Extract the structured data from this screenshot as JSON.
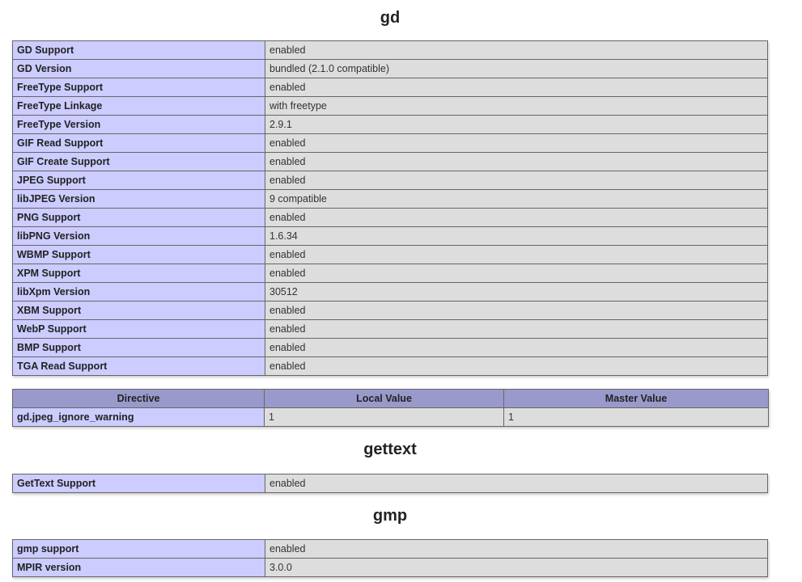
{
  "sections": {
    "gd": {
      "title": "gd",
      "rows": [
        {
          "label": "GD Support",
          "value": "enabled"
        },
        {
          "label": "GD Version",
          "value": "bundled (2.1.0 compatible)"
        },
        {
          "label": "FreeType Support",
          "value": "enabled"
        },
        {
          "label": "FreeType Linkage",
          "value": "with freetype"
        },
        {
          "label": "FreeType Version",
          "value": "2.9.1"
        },
        {
          "label": "GIF Read Support",
          "value": "enabled"
        },
        {
          "label": "GIF Create Support",
          "value": "enabled"
        },
        {
          "label": "JPEG Support",
          "value": "enabled"
        },
        {
          "label": "libJPEG Version",
          "value": "9 compatible"
        },
        {
          "label": "PNG Support",
          "value": "enabled"
        },
        {
          "label": "libPNG Version",
          "value": "1.6.34"
        },
        {
          "label": "WBMP Support",
          "value": "enabled"
        },
        {
          "label": "XPM Support",
          "value": "enabled"
        },
        {
          "label": "libXpm Version",
          "value": "30512"
        },
        {
          "label": "XBM Support",
          "value": "enabled"
        },
        {
          "label": "WebP Support",
          "value": "enabled"
        },
        {
          "label": "BMP Support",
          "value": "enabled"
        },
        {
          "label": "TGA Read Support",
          "value": "enabled"
        }
      ],
      "directives": {
        "headers": [
          "Directive",
          "Local Value",
          "Master Value"
        ],
        "rows": [
          {
            "directive": "gd.jpeg_ignore_warning",
            "local": "1",
            "master": "1"
          }
        ]
      }
    },
    "gettext": {
      "title": "gettext",
      "rows": [
        {
          "label": "GetText Support",
          "value": "enabled"
        }
      ]
    },
    "gmp": {
      "title": "gmp",
      "rows": [
        {
          "label": "gmp support",
          "value": "enabled"
        },
        {
          "label": "MPIR version",
          "value": "3.0.0"
        }
      ]
    }
  },
  "colors": {
    "label_cell_bg": "#ccccff",
    "value_cell_bg": "#dddddd",
    "header_bg": "#9999cc",
    "border": "#666666"
  }
}
